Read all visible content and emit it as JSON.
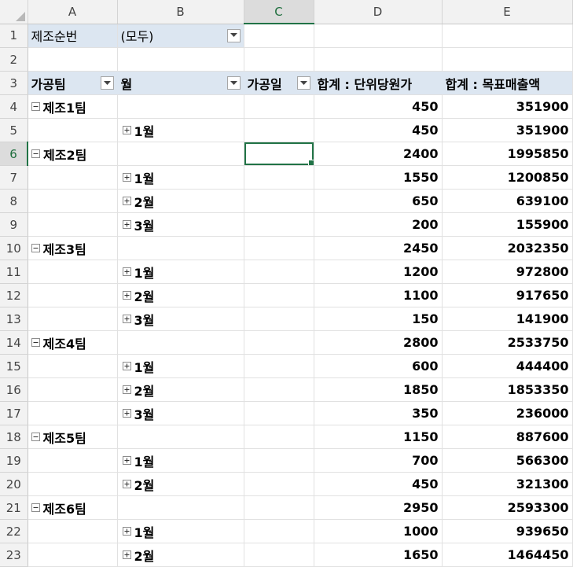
{
  "columns": [
    "A",
    "B",
    "C",
    "D",
    "E"
  ],
  "rows": [
    "1",
    "2",
    "3",
    "4",
    "5",
    "6",
    "7",
    "8",
    "9",
    "10",
    "11",
    "12",
    "13",
    "14",
    "15",
    "16",
    "17",
    "18",
    "19",
    "20",
    "21",
    "22",
    "23"
  ],
  "filter": {
    "label": "제조순번",
    "value": "(모두)"
  },
  "pivot_header": {
    "row_label": "가공팀",
    "month_label": "월",
    "date_label": "가공일",
    "sum1_label": "합계 : 단위당원가",
    "sum2_label": "합계 : 목표매출액"
  },
  "pivot_rows": [
    {
      "kind": "team",
      "label": "제조1팀",
      "v1": "450",
      "v2": "351900"
    },
    {
      "kind": "month",
      "label": "1월",
      "v1": "450",
      "v2": "351900"
    },
    {
      "kind": "team",
      "label": "제조2팀",
      "v1": "2400",
      "v2": "1995850"
    },
    {
      "kind": "month",
      "label": "1월",
      "v1": "1550",
      "v2": "1200850"
    },
    {
      "kind": "month",
      "label": "2월",
      "v1": "650",
      "v2": "639100"
    },
    {
      "kind": "month",
      "label": "3월",
      "v1": "200",
      "v2": "155900"
    },
    {
      "kind": "team",
      "label": "제조3팀",
      "v1": "2450",
      "v2": "2032350"
    },
    {
      "kind": "month",
      "label": "1월",
      "v1": "1200",
      "v2": "972800"
    },
    {
      "kind": "month",
      "label": "2월",
      "v1": "1100",
      "v2": "917650"
    },
    {
      "kind": "month",
      "label": "3월",
      "v1": "150",
      "v2": "141900"
    },
    {
      "kind": "team",
      "label": "제조4팀",
      "v1": "2800",
      "v2": "2533750"
    },
    {
      "kind": "month",
      "label": "1월",
      "v1": "600",
      "v2": "444400"
    },
    {
      "kind": "month",
      "label": "2월",
      "v1": "1850",
      "v2": "1853350"
    },
    {
      "kind": "month",
      "label": "3월",
      "v1": "350",
      "v2": "236000"
    },
    {
      "kind": "team",
      "label": "제조5팀",
      "v1": "1150",
      "v2": "887600"
    },
    {
      "kind": "month",
      "label": "1월",
      "v1": "700",
      "v2": "566300"
    },
    {
      "kind": "month",
      "label": "2월",
      "v1": "450",
      "v2": "321300"
    },
    {
      "kind": "team",
      "label": "제조6팀",
      "v1": "2950",
      "v2": "2593300"
    },
    {
      "kind": "month",
      "label": "1월",
      "v1": "1000",
      "v2": "939650"
    },
    {
      "kind": "month",
      "label": "2월",
      "v1": "1650",
      "v2": "1464450"
    }
  ],
  "selection": {
    "column": "C",
    "row": "6"
  },
  "icons": {
    "filter_dropdown": "dropdown-arrow-icon",
    "collapse": "minus-box-icon",
    "expand": "plus-box-icon"
  },
  "colors": {
    "pivot_header_bg": "#dce6f1",
    "selection_green": "#217346",
    "group_line": "#9bb7d9"
  }
}
